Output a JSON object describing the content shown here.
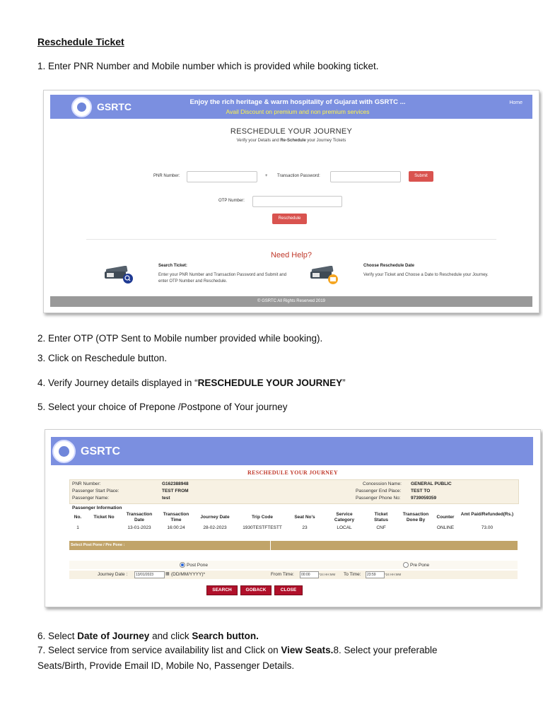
{
  "doc": {
    "heading": "Reschedule Ticket",
    "step1": "1.    Enter PNR Number and Mobile number which is provided while booking ticket.",
    "step2": "2. Enter OTP (OTP Sent to Mobile number provided while booking).",
    "step3": "3. Click on Reschedule button.",
    "step4_prefix": "4. Verify Journey details displayed in “",
    "step4_bold": "RESCHEDULE YOUR JOURNEY",
    "step4_suffix": "”",
    "step5": "5. Select your choice of Prepone /Postpone of Your journey",
    "step6_a": "6. Select ",
    "step6_b": "Date of Journey",
    "step6_c": " and click ",
    "step6_d": "Search button.",
    "step7_a": "7. Select service from service availability list and Click on ",
    "step7_b": "View Seats.",
    "step7_c": "8. Select your preferable",
    "step7_line2": "Seats/Birth, Provide Email ID, Mobile No, Passenger Details."
  },
  "shot1": {
    "brand": "GSRTC",
    "tagline": "Enjoy the rich heritage & warm hospitality of Gujarat with GSRTC ...",
    "tagline2": "Avail Discount on premium and non premium services",
    "home": "Home",
    "title": "RESCHEDULE YOUR JOURNEY",
    "sub_a": "Verify your Details and ",
    "sub_b": "Re-Schedule",
    "sub_c": " your Journey Tickets",
    "pnr_label": "PNR Number:",
    "plus": "+",
    "password_label": "Transaction Password:",
    "submit": "Submit",
    "otp_label": "OTP Number:",
    "reschedule": "Reschedule",
    "need_help": "Need Help?",
    "search_title": "Search Ticket:",
    "search_text": "Enter your PNR Number and Transaction Password and Submit and enter OTP Number and Reschedule.",
    "choose_title": "Choose Reschedule Date",
    "choose_text": "Verify your Ticket and Choose a Date to Reschedule your Journey.",
    "ticket_badge": "TICKET",
    "footer": "© GSRTC All Rights Reserved 2019"
  },
  "shot2": {
    "brand": "GSRTC",
    "title": "RESCHEDULE YOUR JOURNEY",
    "info": {
      "pnr_label": "PNR Number:",
      "pnr_value": "G162388948",
      "start_label": "Passenger Start Place:",
      "start_value": "TEST FROM",
      "name_label": "Passenger Name:",
      "name_value": "test",
      "concession_label": "Concession Name:",
      "concession_value": "GENERAL PUBLIC",
      "end_label": "Passenger End Place:",
      "end_value": "TEST TO",
      "phone_label": "Passenger Phone No:",
      "phone_value": "9739059359"
    },
    "passenger_info": "Passenger Information",
    "columns": [
      "No.",
      "Ticket No",
      "Transaction Date",
      "Transaction Time",
      "Journey Date",
      "Trip Code",
      "Seat No's",
      "Service Category",
      "Ticket Status",
      "Transaction Done By",
      "Counter",
      "Amt Paid/Refunded(Rs.)"
    ],
    "row": [
      "1",
      "",
      "13-01-2023",
      "16:00:24",
      "28-02-2023",
      "1930TESTFTESTT",
      "23",
      "LOCAL",
      "CNF",
      "",
      "ONLINE",
      "73.00"
    ],
    "select_bar": "Select Post Pone / Pre Pone :",
    "postpone": "Post Pone",
    "prepone": "Pre Pone",
    "journey_date_label": "Journey Date :",
    "journey_date_value": "13/01/2023",
    "date_format": "(DD/MM/YYYY)*",
    "from_time_label": "From Time:",
    "from_time_value": "00:00",
    "to_time_label": "To Time:",
    "to_time_value": "23:59",
    "time_hint": "*24 HH:MM",
    "buttons": {
      "search": "SEARCH",
      "goback": "GOBACK",
      "close": "CLOSE"
    }
  }
}
